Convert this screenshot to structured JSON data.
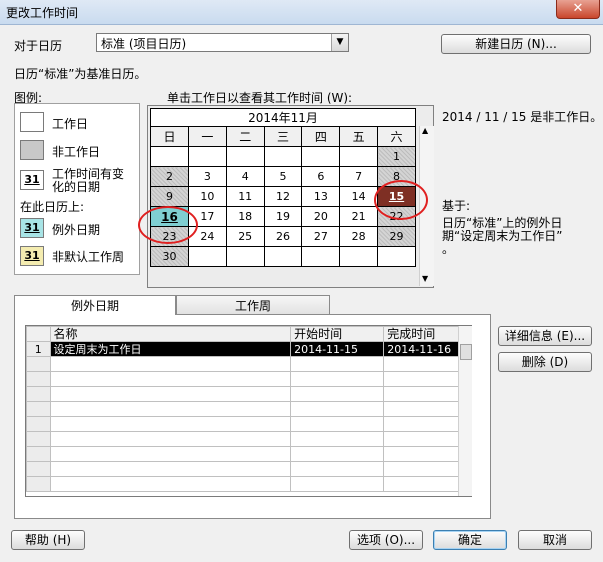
{
  "window": {
    "title": "更改工作时间",
    "close_glyph": "✕"
  },
  "for_calendar": {
    "label": "对于日历",
    "value": "标准 (项目日历)"
  },
  "new_calendar_button": "新建日历 (N)...",
  "base_calendar_text": "日历“标准”为基准日历。",
  "legend": {
    "title": "图例:",
    "working_day": "工作日",
    "nonworking_day": "非工作日",
    "edited_hours_line1": "工作时间有变",
    "edited_hours_line2": "化的日期",
    "on_this_calendar": "在此日历上:",
    "exception_day": "例外日期",
    "nondefault_week": "非默认工作周",
    "swatch_number": "31"
  },
  "calendar": {
    "instruction": "单击工作日以查看其工作时间 (W):",
    "month_title": "2014年11月",
    "weekdays": [
      "日",
      "一",
      "二",
      "三",
      "四",
      "五",
      "六"
    ],
    "weeks": [
      [
        "",
        "",
        "",
        "",
        "",
        "",
        "1"
      ],
      [
        "2",
        "3",
        "4",
        "5",
        "6",
        "7",
        "8"
      ],
      [
        "9",
        "10",
        "11",
        "12",
        "13",
        "14",
        "15"
      ],
      [
        "16",
        "17",
        "18",
        "19",
        "20",
        "21",
        "22"
      ],
      [
        "23",
        "24",
        "25",
        "26",
        "27",
        "28",
        "29"
      ],
      [
        "30",
        "",
        "",
        "",
        "",
        "",
        ""
      ]
    ],
    "scroll_up": "▲",
    "scroll_down": "▼"
  },
  "info": {
    "status_text": "2014 / 11 / 15 是非工作日。",
    "based_on_label": "基于:",
    "based_on_line1": "日历“标准”上的例外日",
    "based_on_line2": "期“设定周末为工作日”",
    "based_on_line3": "。"
  },
  "tabs": [
    {
      "label": "例外日期",
      "active": true
    },
    {
      "label": "工作周",
      "active": false
    }
  ],
  "exceptions_table": {
    "columns": [
      "名称",
      "开始时间",
      "完成时间"
    ],
    "rows": [
      {
        "index": "1",
        "name": "设定周末为工作日",
        "start": "2014-11-15",
        "finish": "2014-11-16"
      }
    ]
  },
  "side_buttons": {
    "details": "详细信息 (E)...",
    "delete": "删除 (D)"
  },
  "footer_buttons": {
    "help": "帮助 (H)",
    "options": "选项 (O)...",
    "ok": "确定",
    "cancel": "取消"
  },
  "colors": {
    "exception": "#7e2f24",
    "selected": "#7fcfd2",
    "highlight_ring": "#e02020"
  }
}
